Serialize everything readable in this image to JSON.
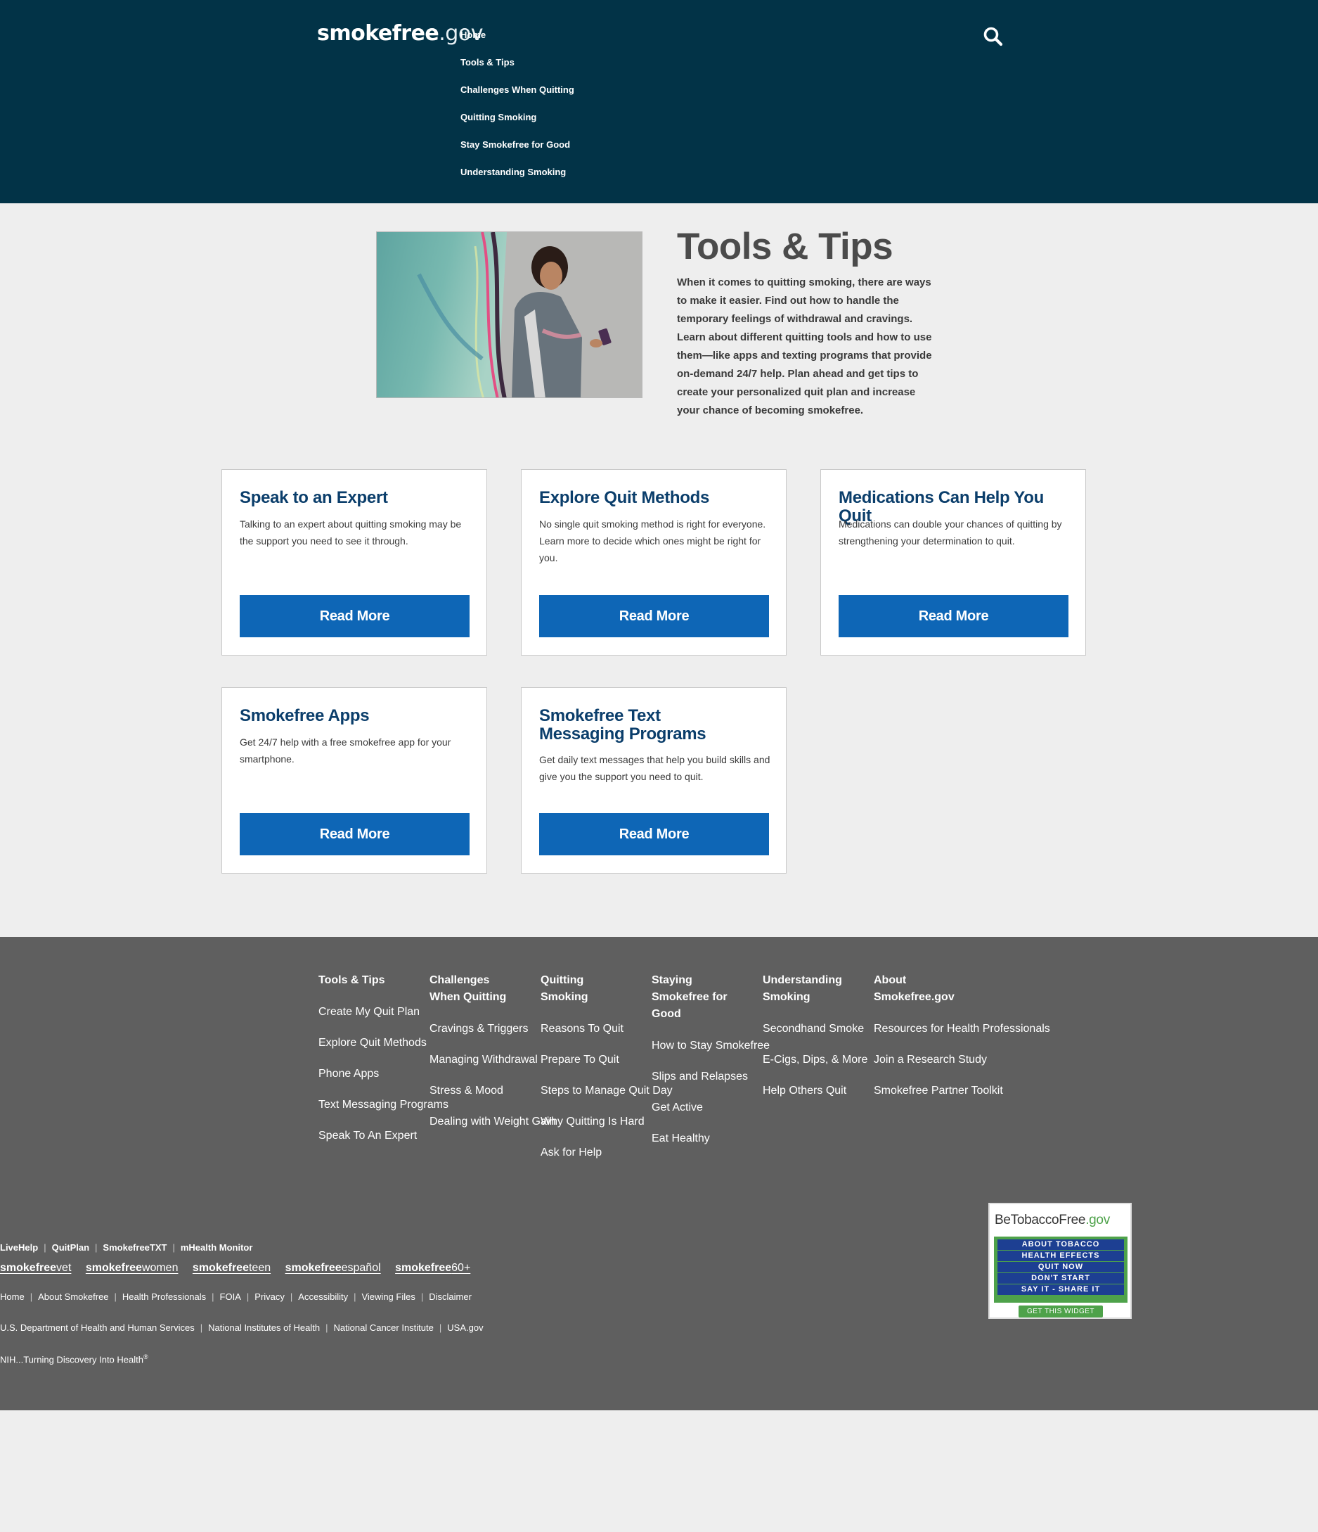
{
  "header": {
    "logo_bold": "smokefree",
    "logo_suffix": ".gov",
    "nav": [
      "Home",
      "Tools & Tips",
      "Challenges When Quitting",
      "Quitting Smoking",
      "Stay Smokefree for Good",
      "Understanding Smoking"
    ],
    "search_icon": "search-icon"
  },
  "intro": {
    "title": "Tools & Tips",
    "text": "When it comes to quitting smoking, there are ways to make it easier. Find out how to handle the temporary feelings of withdrawal and cravings. Learn about different quitting tools and how to use them—like apps and texting programs that provide on-demand 24/7 help. Plan ahead and get tips to create your personalized quit plan and increase your chance of becoming smokefree."
  },
  "cards": [
    {
      "title": "Speak to an Expert",
      "desc": "Talking to an expert about quitting smoking may be the support you need to see it through.",
      "button": "Read More"
    },
    {
      "title": "Explore Quit Methods",
      "desc": "No single quit smoking method is right for everyone. Learn more to decide which ones might be right for you.",
      "button": "Read More"
    },
    {
      "title": "Medications Can Help You Quit",
      "desc": "Medications can double your chances of quitting by strengthening your determination to quit.",
      "button": "Read More"
    },
    {
      "title": "Smokefree Apps",
      "desc": "Get 24/7 help with a free smokefree app for your smartphone.",
      "button": "Read More"
    },
    {
      "title": "Smokefree Text Messaging Programs",
      "desc": "Get daily text messages that help you build skills and give you the support you need to quit.",
      "button": "Read More"
    }
  ],
  "footer": {
    "columns": [
      {
        "heading": "Tools & Tips",
        "links": [
          "Create My Quit Plan",
          "Explore Quit Methods",
          "Phone Apps",
          "Text Messaging Programs",
          "Speak To An Expert"
        ]
      },
      {
        "heading": "Challenges When Quitting",
        "links": [
          "Cravings & Triggers",
          "Managing Withdrawal",
          "Stress & Mood",
          "Dealing with Weight Gain"
        ]
      },
      {
        "heading": "Quitting Smoking",
        "links": [
          "Reasons To Quit",
          "Prepare To Quit",
          "Steps to Manage Quit Day",
          "Why Quitting Is Hard",
          "Ask for Help"
        ]
      },
      {
        "heading": "Staying Smokefree for Good",
        "links": [
          "How to Stay Smokefree",
          "Slips and Relapses",
          "Get Active",
          "Eat Healthy"
        ]
      },
      {
        "heading": "Understanding Smoking",
        "links": [
          "Secondhand Smoke",
          "E-Cigs, Dips, & More",
          "Help Others Quit"
        ]
      },
      {
        "heading": "About Smokefree.gov",
        "links": [
          "Resources for Health Professionals",
          "Join a Research Study",
          "Smokefree Partner Toolkit"
        ]
      }
    ],
    "programs": [
      "LiveHelp",
      "QuitPlan",
      "SmokefreeTXT",
      "mHealth Monitor"
    ],
    "sites": [
      {
        "bold": "smokefree",
        "light": "vet"
      },
      {
        "bold": "smokefree",
        "light": "women"
      },
      {
        "bold": "smokefree",
        "light": "teen"
      },
      {
        "bold": "smokefree",
        "light": "español"
      },
      {
        "bold": "smokefree",
        "light": "60+"
      }
    ],
    "links": [
      "Home",
      "About Smokefree",
      "Health Professionals",
      "FOIA",
      "Privacy",
      "Accessibility",
      "Viewing Files",
      "Disclaimer"
    ],
    "agencies": [
      "U.S. Department of Health and Human Services",
      "National Institutes of Health",
      "National Cancer Institute",
      "USA.gov"
    ],
    "tagline": "NIH...Turning Discovery Into Health",
    "tagline_mark": "®"
  },
  "widget": {
    "title_main": "BeTobaccoFree",
    "title_suffix": ".gov",
    "items": [
      "ABOUT TOBACCO",
      "HEALTH EFFECTS",
      "QUIT NOW",
      "DON'T START",
      "SAY IT - SHARE IT"
    ],
    "button": "GET THIS WIDGET"
  },
  "colors": {
    "header_bg": "#023347",
    "page_bg": "#eeeeee",
    "card_title": "#0b3e6b",
    "button_bg": "#0e66b6",
    "footer_bg": "#5f5f5f",
    "widget_green": "#4ea24a",
    "widget_blue": "#1d3f92"
  }
}
